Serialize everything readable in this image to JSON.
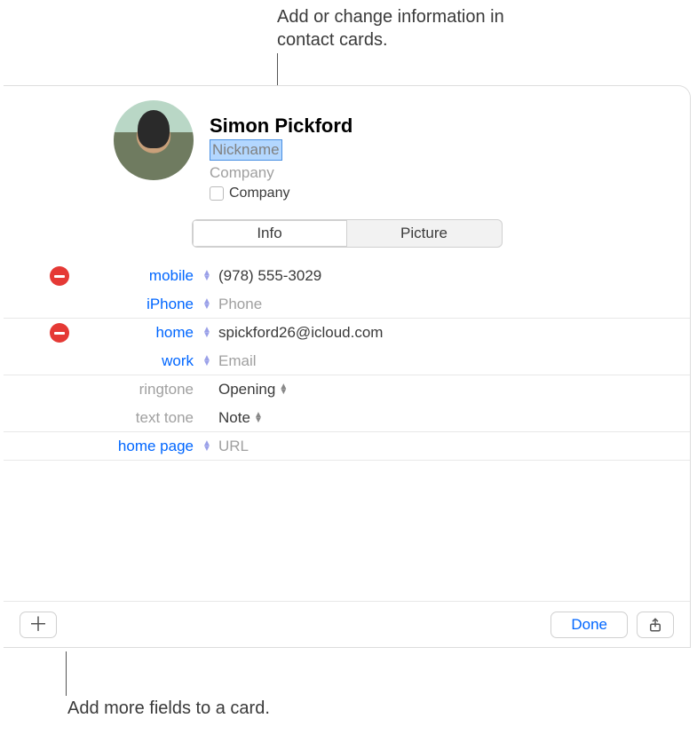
{
  "callouts": {
    "top": "Add or change information in contact cards.",
    "bottom": "Add more fields to a card."
  },
  "contact": {
    "name": "Simon Pickford",
    "nickname_placeholder": "Nickname",
    "company_placeholder": "Company",
    "company_checkbox_label": "Company"
  },
  "tabs": {
    "info": "Info",
    "picture": "Picture"
  },
  "rows": {
    "mobile": {
      "label": "mobile",
      "value": "(978) 555-3029"
    },
    "iphone": {
      "label": "iPhone",
      "placeholder": "Phone"
    },
    "home_email": {
      "label": "home",
      "value": "spickford26@icloud.com"
    },
    "work_email": {
      "label": "work",
      "placeholder": "Email"
    },
    "ringtone": {
      "label": "ringtone",
      "value": "Opening"
    },
    "texttone": {
      "label": "text tone",
      "value": "Note"
    },
    "homepage": {
      "label": "home page",
      "placeholder": "URL"
    }
  },
  "footer": {
    "done": "Done"
  }
}
